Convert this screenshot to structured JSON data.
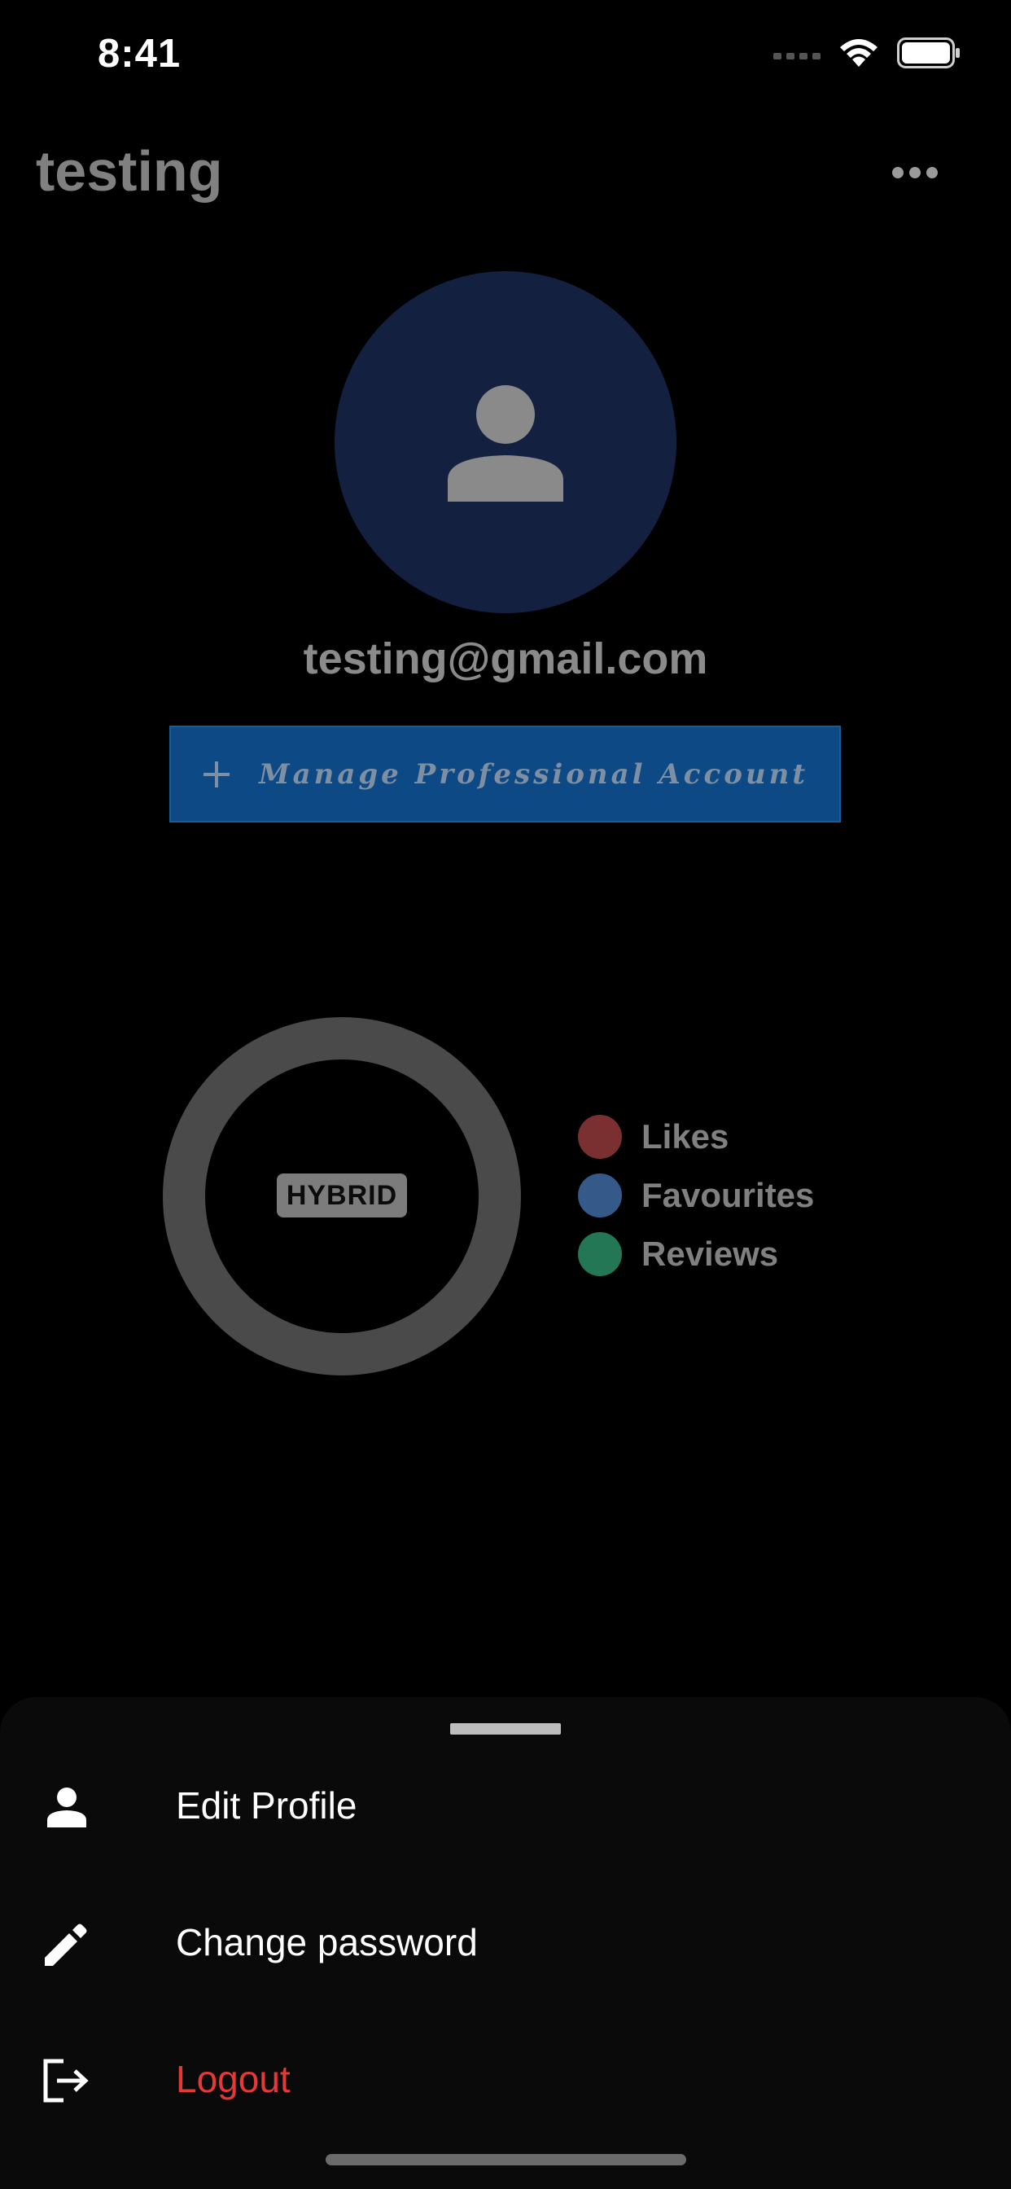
{
  "status_bar": {
    "time": "8:41"
  },
  "header": {
    "title": "testing",
    "more_icon": "more-horizontal-icon"
  },
  "profile": {
    "avatar_icon": "person-icon",
    "avatar_color": "#13203f",
    "email": "testing@gmail.com",
    "manage_button": {
      "icon": "plus-icon",
      "label": "Manage Professional Account",
      "color": "#0d4a85"
    }
  },
  "stats": {
    "badge": "HYBRID",
    "legend": [
      {
        "label": "Likes",
        "color": "#7a3030"
      },
      {
        "label": "Favourites",
        "color": "#355a8a"
      },
      {
        "label": "Reviews",
        "color": "#237754"
      }
    ]
  },
  "bottom_sheet": {
    "items": [
      {
        "label": "Edit Profile",
        "icon": "person-icon"
      },
      {
        "label": "Change password",
        "icon": "pencil-icon"
      },
      {
        "label": "Logout",
        "icon": "logout-icon",
        "color": "#e53935"
      }
    ]
  }
}
